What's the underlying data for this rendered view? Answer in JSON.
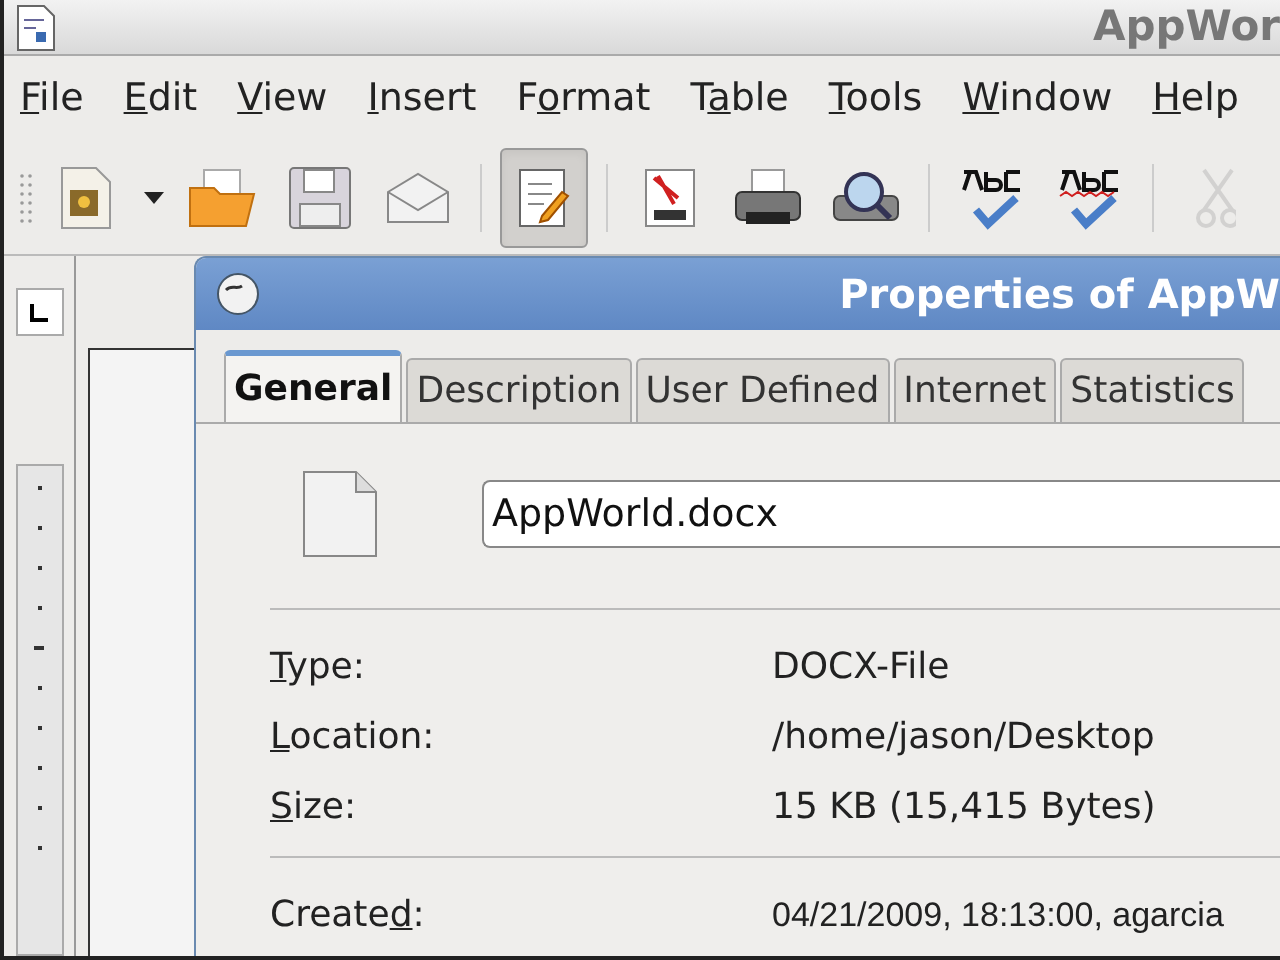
{
  "window": {
    "title": "AppWor"
  },
  "menu": [
    {
      "key": "F",
      "post": "ile"
    },
    {
      "key": "E",
      "post": "dit"
    },
    {
      "key": "V",
      "post": "iew"
    },
    {
      "key": "I",
      "post": "nsert"
    },
    {
      "pre": "F",
      "key": "o",
      "post": "rmat"
    },
    {
      "pre": "T",
      "key": "a",
      "post": "ble"
    },
    {
      "key": "T",
      "post": "ools"
    },
    {
      "key": "W",
      "post": "indow"
    },
    {
      "key": "H",
      "post": "elp"
    }
  ],
  "toolbar": [
    {
      "kind": "button",
      "selected": false
    },
    {
      "kind": "dropdown"
    },
    {
      "kind": "button",
      "selected": false
    },
    {
      "kind": "button",
      "selected": false
    },
    {
      "kind": "button",
      "selected": false
    },
    {
      "kind": "separator"
    },
    {
      "kind": "button",
      "selected": true
    },
    {
      "kind": "separator"
    },
    {
      "kind": "button",
      "selected": false
    },
    {
      "kind": "button",
      "selected": false
    },
    {
      "kind": "button",
      "selected": false
    },
    {
      "kind": "separator"
    },
    {
      "kind": "button",
      "selected": false
    },
    {
      "kind": "button",
      "selected": false
    },
    {
      "kind": "separator"
    },
    {
      "kind": "button",
      "selected": false,
      "disabled": true
    }
  ],
  "dialog": {
    "title": "Properties of AppW",
    "tabs": [
      {
        "label": "General",
        "selected": true
      },
      {
        "label": "Description",
        "selected": false
      },
      {
        "label": "User Defined",
        "selected": false
      },
      {
        "label": "Internet",
        "selected": false
      },
      {
        "label": "Statistics",
        "selected": false
      }
    ],
    "file_name": "AppWorld.docx",
    "info": [
      {
        "key": "T",
        "post": "ype:",
        "value": "DOCX-File"
      },
      {
        "key": "L",
        "post": "ocation:",
        "value": "/home/jason/Desktop"
      },
      {
        "key": "S",
        "post": "ize:",
        "value": "15 KB (15,415 Bytes)"
      }
    ],
    "dates": [
      {
        "pre": "Create",
        "key": "d",
        "post": ":",
        "value": "04/21/2009, 18:13:00, agarcia"
      }
    ]
  }
}
